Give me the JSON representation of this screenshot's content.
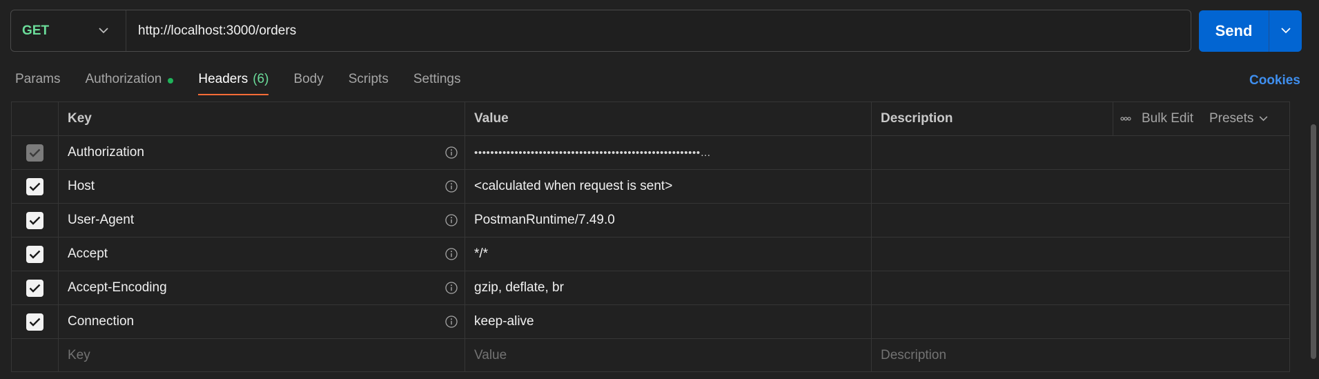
{
  "request": {
    "method": "GET",
    "url": "http://localhost:3000/orders",
    "send_label": "Send"
  },
  "tabs": [
    {
      "label": "Params"
    },
    {
      "label": "Authorization"
    },
    {
      "label": "Headers",
      "count": "(6)"
    },
    {
      "label": "Body"
    },
    {
      "label": "Scripts"
    },
    {
      "label": "Settings"
    }
  ],
  "cookies_label": "Cookies",
  "table": {
    "headers": {
      "key": "Key",
      "value": "Value",
      "description": "Description"
    },
    "actions": {
      "bulk_edit": "Bulk Edit",
      "presets": "Presets"
    },
    "rows": [
      {
        "key": "Authorization",
        "value": "••••••••••••••••••••••••••••••••••••••••••••••••••••••••…",
        "description": "",
        "checked": true,
        "disabled": true
      },
      {
        "key": "Host",
        "value": "<calculated when request is sent>",
        "description": "",
        "checked": true,
        "disabled": false
      },
      {
        "key": "User-Agent",
        "value": "PostmanRuntime/7.49.0",
        "description": "",
        "checked": true,
        "disabled": false
      },
      {
        "key": "Accept",
        "value": "*/*",
        "description": "",
        "checked": true,
        "disabled": false
      },
      {
        "key": "Accept-Encoding",
        "value": "gzip, deflate, br",
        "description": "",
        "checked": true,
        "disabled": false
      },
      {
        "key": "Connection",
        "value": "keep-alive",
        "description": "",
        "checked": true,
        "disabled": false
      }
    ],
    "placeholders": {
      "key": "Key",
      "value": "Value",
      "description": "Description"
    }
  },
  "colors": {
    "accent_send": "#0265d2",
    "method_get": "#6bdd9a",
    "tab_underline": "#ff6c37",
    "cookies_link": "#3f8fef",
    "auth_dot": "#1fb35a"
  }
}
